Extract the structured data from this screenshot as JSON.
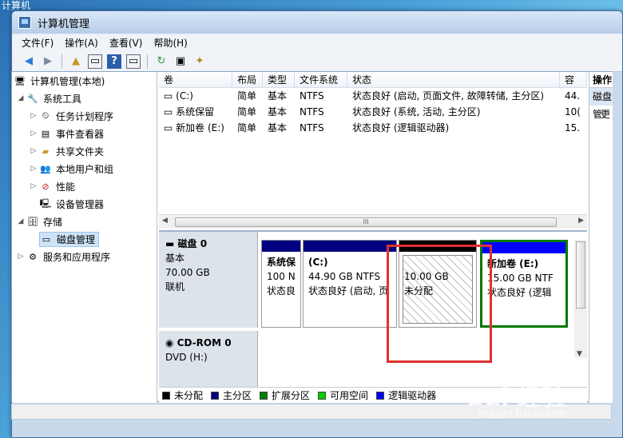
{
  "desktop_title": "计算机",
  "window": {
    "title": "计算机管理"
  },
  "menu": [
    "文件(F)",
    "操作(A)",
    "查看(V)",
    "帮助(H)"
  ],
  "tree": {
    "root": "计算机管理(本地)",
    "system_tools": "系统工具",
    "items": [
      "任务计划程序",
      "事件查看器",
      "共享文件夹",
      "本地用户和组",
      "性能",
      "设备管理器"
    ],
    "storage": "存储",
    "disk_mgmt": "磁盘管理",
    "services": "服务和应用程序"
  },
  "list": {
    "headers": [
      "卷",
      "布局",
      "类型",
      "文件系统",
      "状态",
      "容"
    ],
    "rows": [
      {
        "vol": "(C:)",
        "layout": "简单",
        "type": "基本",
        "fs": "NTFS",
        "status": "状态良好 (启动, 页面文件, 故障转储, 主分区)",
        "cap": "44."
      },
      {
        "vol": "系统保留",
        "layout": "简单",
        "type": "基本",
        "fs": "NTFS",
        "status": "状态良好 (系统, 活动, 主分区)",
        "cap": "10("
      },
      {
        "vol": "新加卷 (E:)",
        "layout": "简单",
        "type": "基本",
        "fs": "NTFS",
        "status": "状态良好 (逻辑驱动器)",
        "cap": "15."
      }
    ],
    "scroll_mark": "III"
  },
  "disk0": {
    "name": "磁盘 0",
    "type": "基本",
    "size": "70.00 GB",
    "state": "联机",
    "partitions": [
      {
        "name": "系统保",
        "size": "100 N",
        "status": "状态良"
      },
      {
        "name": "(C:)",
        "size": "44.90 GB NTFS",
        "status": "状态良好 (启动, 页"
      },
      {
        "name": "",
        "size": "10.00 GB",
        "status": "未分配"
      },
      {
        "name": "新加卷 (E:)",
        "size": "15.00 GB NTF",
        "status": "状态良好 (逻辑"
      }
    ]
  },
  "cdrom": {
    "name": "CD-ROM 0",
    "type": "DVD (H:)"
  },
  "legend": [
    {
      "label": "未分配",
      "color": "#000000"
    },
    {
      "label": "主分区",
      "color": "#000080"
    },
    {
      "label": "扩展分区",
      "color": "#008000"
    },
    {
      "label": "可用空间",
      "color": "#00d000"
    },
    {
      "label": "逻辑驱动器",
      "color": "#0000ff"
    }
  ],
  "actions": {
    "title": "操作",
    "item": "磁盘管",
    "more": "更"
  },
  "watermark": {
    "logo": "Bai 经验",
    "url": "jingyan.baidu.com"
  }
}
